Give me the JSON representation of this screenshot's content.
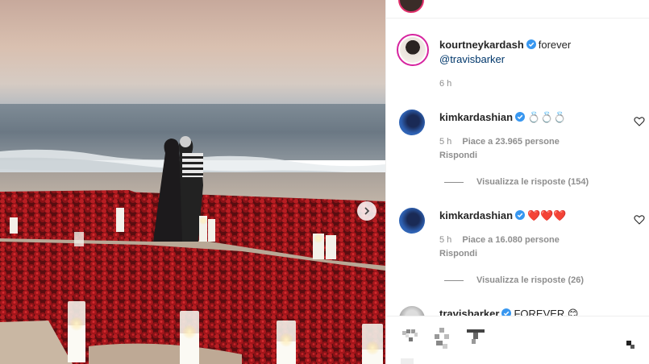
{
  "post": {
    "author": "kourtneykardash",
    "caption": "forever",
    "mention": "@travisbarker",
    "time": "6 h"
  },
  "comments": [
    {
      "username": "kimkardashian",
      "text": "💍💍💍",
      "time": "5 h",
      "likes": "Piace a 23.965 persone",
      "reply": "Rispondi",
      "view_replies": "Visualizza le risposte (154)"
    },
    {
      "username": "kimkardashian",
      "text": "❤️❤️❤️",
      "time": "5 h",
      "likes": "Piace a 16.080 persone",
      "reply": "Rispondi",
      "view_replies": "Visualizza le risposte (26)"
    },
    {
      "username": "travisbarker",
      "text": "FOREVER 😊"
    }
  ],
  "colors": {
    "verified": "#3897f0",
    "mention": "#00376b",
    "meta": "#8e8e8e",
    "heart_red": "#e0245e",
    "story_ring": "#d6249f"
  },
  "icons": [
    "chevron-right-icon",
    "verified-icon",
    "heart-outline-icon",
    "ring-emoji-icon",
    "red-heart-emoji-icon",
    "expand-icon"
  ]
}
